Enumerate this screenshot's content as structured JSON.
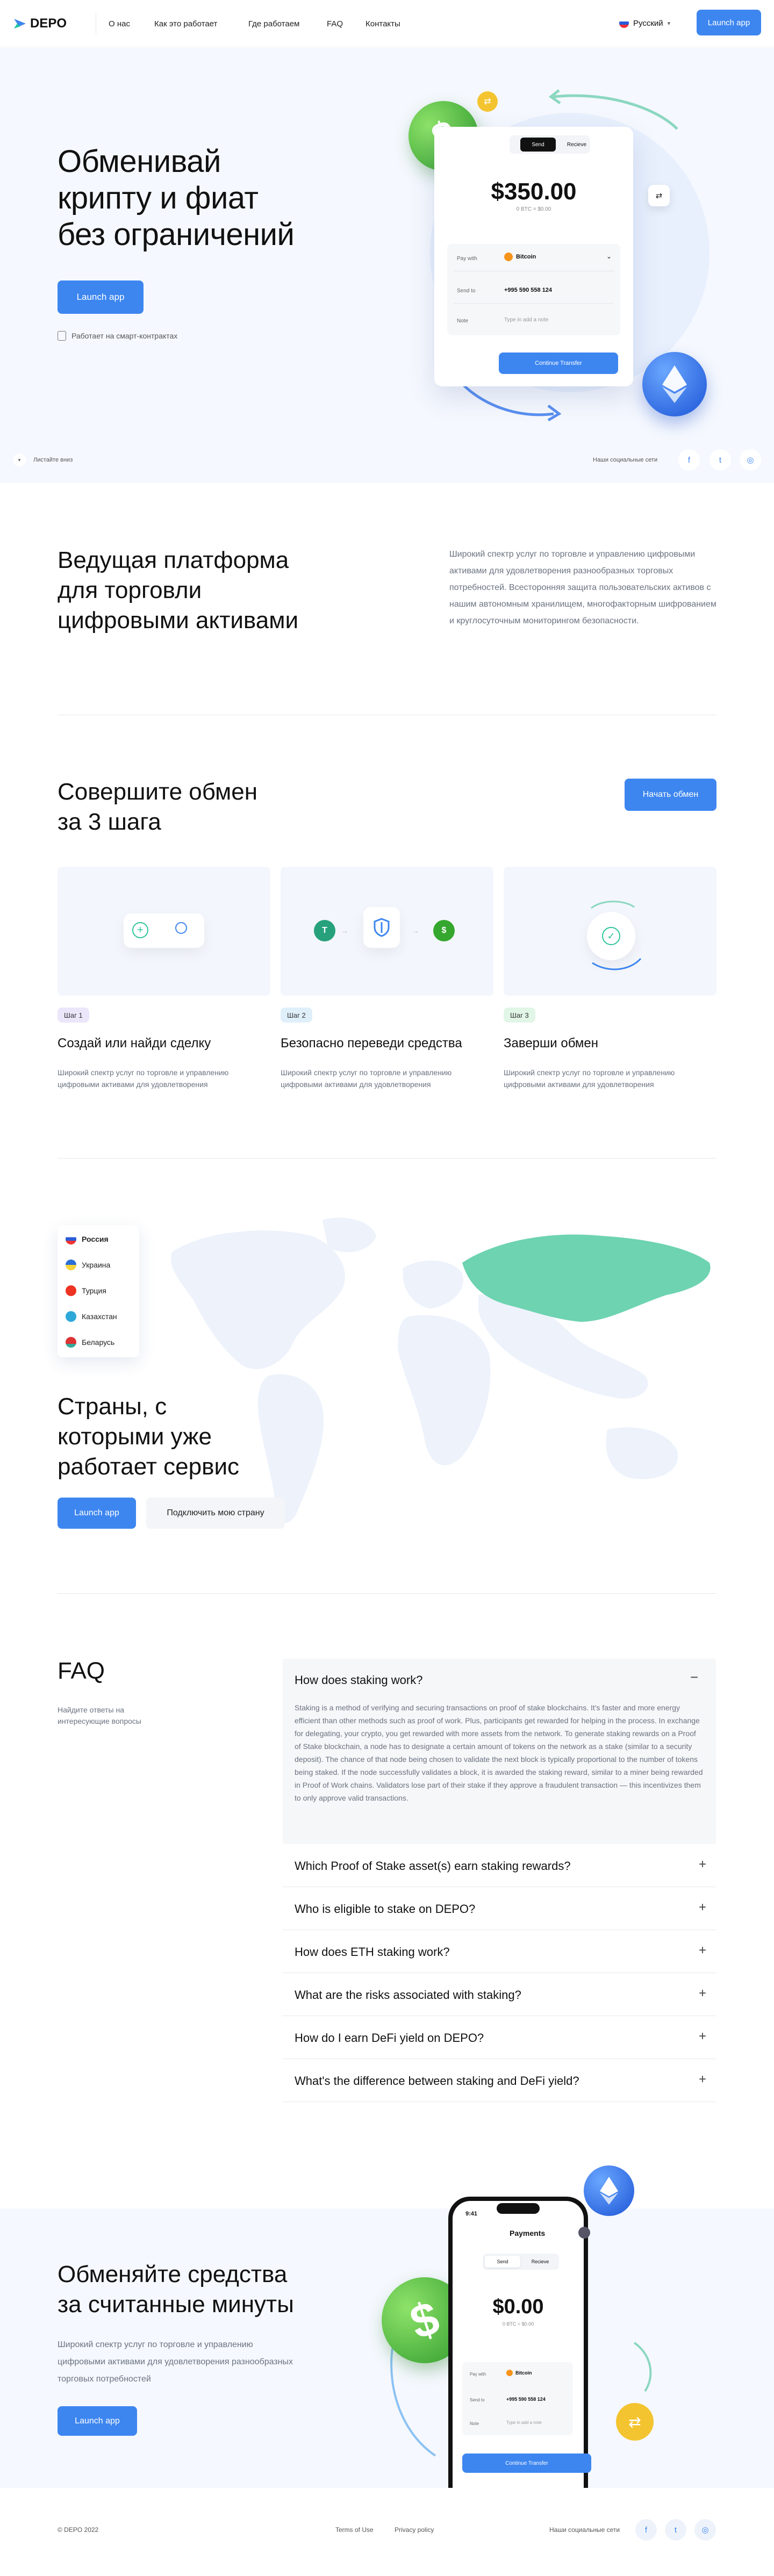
{
  "header": {
    "logo": "DEPO",
    "nav": [
      "О нас",
      "Как это работает",
      "Где работаем",
      "FAQ",
      "Контакты"
    ],
    "language": "Русский",
    "launch": "Launch app"
  },
  "hero": {
    "title_l1": "Обменивай",
    "title_l2": "крипту и фиат",
    "title_l3": "без ограничений",
    "cta": "Launch app",
    "note": "Работает на смарт-контрактах",
    "scroll": "Листайте вниз",
    "social_label": "Наши социальные сети",
    "card": {
      "tab_send": "Send",
      "tab_recieve": "Recieve",
      "amount": "$350.00",
      "sub": "0 BTC = $0.00",
      "pay_label": "Pay with",
      "pay_value": "Bitcoin",
      "send_label": "Send to",
      "send_value": "+995 590 558 124",
      "note_label": "Note",
      "note_placeholder": "Type in add a note",
      "button": "Continue Transfer"
    }
  },
  "about": {
    "title_l1": "Ведущая платформа",
    "title_l2": "для торговли",
    "title_l3": "цифровыми активами",
    "text": "Широкий спектр услуг по торговле и управлению цифровыми активами для удовлетворения разнообразных торговых потребностей. Всесторонняя защита пользовательских активов с нашим автономным хранилищем, многофакторным шифрованием и круглосуточным мониторингом безопасности."
  },
  "steps": {
    "title_l1": "Совершите обмен",
    "title_l2": "за 3 шага",
    "cta": "Начать обмен",
    "items": [
      {
        "badge": "Шаг 1",
        "title": "Создай или найди сделку",
        "text": "Широкий спектр услуг по торговле и управлению цифровыми активами для удовлетворения"
      },
      {
        "badge": "Шаг 2",
        "title": "Безопасно переведи средства",
        "text": "Широкий спектр услуг по торговле и управлению цифровыми активами для удовлетворения"
      },
      {
        "badge": "Шаг 3",
        "title": "Заверши обмен",
        "text": "Широкий спектр услуг по торговле и управлению цифровыми активами для удовлетворения"
      }
    ]
  },
  "countries": {
    "list": [
      "Россия",
      "Украина",
      "Турция",
      "Казахстан",
      "Беларусь"
    ],
    "title_l1": "Страны, с",
    "title_l2": "которыми уже",
    "title_l3": "работает сервис",
    "cta": "Launch app",
    "secondary": "Подключить мою страну"
  },
  "faq": {
    "title": "FAQ",
    "subtitle": "Найдите ответы на интересующие вопросы",
    "open_q": "How does staking work?",
    "open_a": "Staking is a method of verifying and securing transactions on proof of stake blockchains. It's faster and more energy efficient than other methods such as proof of work. Plus, participants get rewarded for helping in the process. In exchange for delegating, your crypto, you get rewarded with more assets from the network. To generate staking rewards on a Proof of Stake blockchain, a node has to designate a certain amount of tokens on the network as a stake (similar to a security deposit). The chance of that node being chosen to validate the next block is typically proportional to the number of tokens being staked. If the node successfully validates a block, it is awarded the staking reward, similar to a miner being rewarded in Proof of Work chains. Validators lose part of their stake if they approve a fraudulent transaction — this incentivizes them to only approve valid transactions.",
    "questions": [
      "Which Proof of Stake asset(s) earn staking rewards?",
      "Who is eligible to stake on DEPO?",
      "How does ETH staking work?",
      "What are the risks associated with staking?",
      "How do I earn DeFi yield on DEPO?",
      "What's the difference between staking and DeFi yield?"
    ]
  },
  "cta_section": {
    "title_l1": "Обменяйте средства",
    "title_l2": "за считанные минуты",
    "text": "Широкий спектр услуг по торговле и управлению цифровыми активами для удовлетворения разнообразных торговых потребностей",
    "cta": "Launch app",
    "phone": {
      "time": "9:41",
      "title": "Payments",
      "tab_send": "Send",
      "tab_recieve": "Recieve",
      "amount": "$0.00",
      "sub": "0 BTC = $0.00",
      "pay_label": "Pay with",
      "pay_value": "Bitcoin",
      "send_label": "Send to",
      "send_value": "+995 590 558 124",
      "note_label": "Note",
      "note_placeholder": "Type in add a note",
      "button": "Continue Transfer"
    }
  },
  "footer": {
    "copyright": "© DEPO 2022",
    "terms": "Terms of Use",
    "privacy": "Privacy policy",
    "social_label": "Наши социальные сети"
  },
  "colors": {
    "accent": "#3d86f0",
    "hero_bg": "#f5f8fe",
    "map_active": "#6dd3b0"
  }
}
